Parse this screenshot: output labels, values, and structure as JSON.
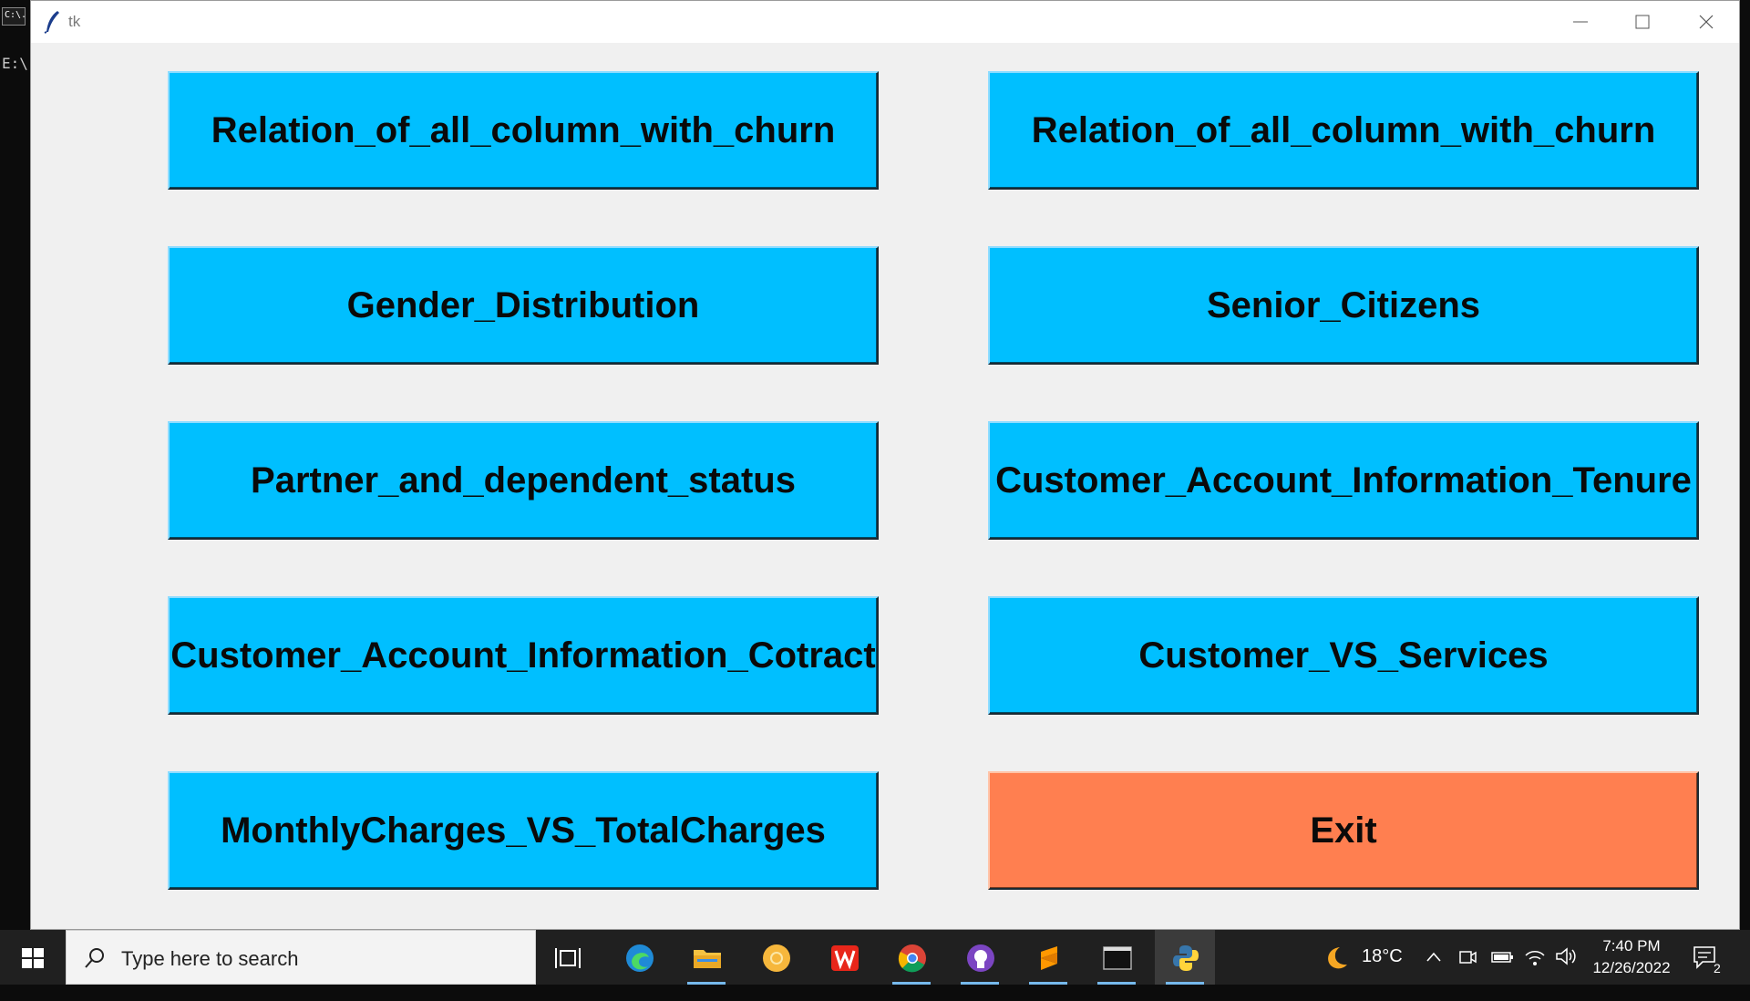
{
  "console": {
    "prompt_text": "E:\\"
  },
  "window": {
    "title": "tk"
  },
  "buttons": {
    "relation_1": "Relation_of_all_column_with_churn",
    "relation_2": "Relation_of_all_column_with_churn",
    "gender": "Gender_Distribution",
    "senior": "Senior_Citizens",
    "partner": "Partner_and_dependent_status",
    "tenure": "Customer_Account_Information_Tenure",
    "contract": "Customer_Account_Information_Cotract",
    "services": "Customer_VS_Services",
    "charges": "MonthlyCharges_VS_TotalCharges",
    "exit": "Exit"
  },
  "colors": {
    "button_bg": "#00bfff",
    "exit_bg": "#ff7f50",
    "window_bg": "#f0f0f0"
  },
  "taskbar": {
    "search_placeholder": "Type here to search",
    "apps": [
      "task-view",
      "edge",
      "file-explorer",
      "chrome-canary",
      "wps-office",
      "chrome",
      "github-desktop",
      "sublime-text",
      "terminal",
      "python"
    ],
    "weather": {
      "icon": "moon-icon",
      "temp": "18°C"
    },
    "clock": {
      "time": "7:40 PM",
      "date": "12/26/2022"
    },
    "notifications": "2"
  }
}
